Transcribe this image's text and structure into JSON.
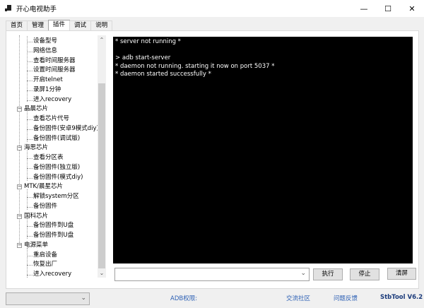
{
  "window": {
    "title": "开心电视助手",
    "minimize": "—",
    "maximize": "☐",
    "close": "✕"
  },
  "tabs": [
    {
      "label": "首页"
    },
    {
      "label": "管理"
    },
    {
      "label": "插件",
      "active": true
    },
    {
      "label": "调试"
    },
    {
      "label": "说明"
    }
  ],
  "tree": {
    "rows": [
      {
        "label": "设备型号",
        "level": 1
      },
      {
        "label": "网络信息",
        "level": 1
      },
      {
        "label": "查看时间服务器",
        "level": 1
      },
      {
        "label": "设置时间服务器",
        "level": 1
      },
      {
        "label": "开启telnet",
        "level": 1
      },
      {
        "label": "录屏1分钟",
        "level": 1
      },
      {
        "label": "进入recovery",
        "level": 1
      },
      {
        "label": "晶晨芯片",
        "level": 0
      },
      {
        "label": "查看芯片代号",
        "level": 1
      },
      {
        "label": "备份固件(安卓9模式diy)",
        "level": 1
      },
      {
        "label": "备份固件(调试版)",
        "level": 1
      },
      {
        "label": "海思芯片",
        "level": 0
      },
      {
        "label": "查看分区表",
        "level": 1
      },
      {
        "label": "备份固件(独立版)",
        "level": 1
      },
      {
        "label": "备份固件(模式diy)",
        "level": 1
      },
      {
        "label": "MTK/晨星芯片",
        "level": 0
      },
      {
        "label": "解锁system分区",
        "level": 1
      },
      {
        "label": "备份固件",
        "level": 1
      },
      {
        "label": "国科芯片",
        "level": 0
      },
      {
        "label": "备份固件到U盘",
        "level": 1
      },
      {
        "label": "备份固件到U盘",
        "level": 1
      },
      {
        "label": "电源菜单",
        "level": 0
      },
      {
        "label": "重启设备",
        "level": 1
      },
      {
        "label": "恢复出厂",
        "level": 1
      },
      {
        "label": "进入recovery",
        "level": 1
      }
    ]
  },
  "terminal": {
    "lines": [
      "* server not running *",
      "",
      "> adb start-server",
      "* daemon not running. starting it now on port 5037 *",
      "* daemon started successfully *"
    ]
  },
  "command": {
    "value": ""
  },
  "buttons": {
    "execute": "执行",
    "stop": "停止",
    "clear": "清屏"
  },
  "statusbar": {
    "device_select": "",
    "adb_permission": "ADB权限:",
    "community": "交流社区",
    "feedback": "问题反馈",
    "version": "StbTool V6.2"
  },
  "colors": {
    "link": "#2b5fb4",
    "terminal_bg": "#000000"
  }
}
